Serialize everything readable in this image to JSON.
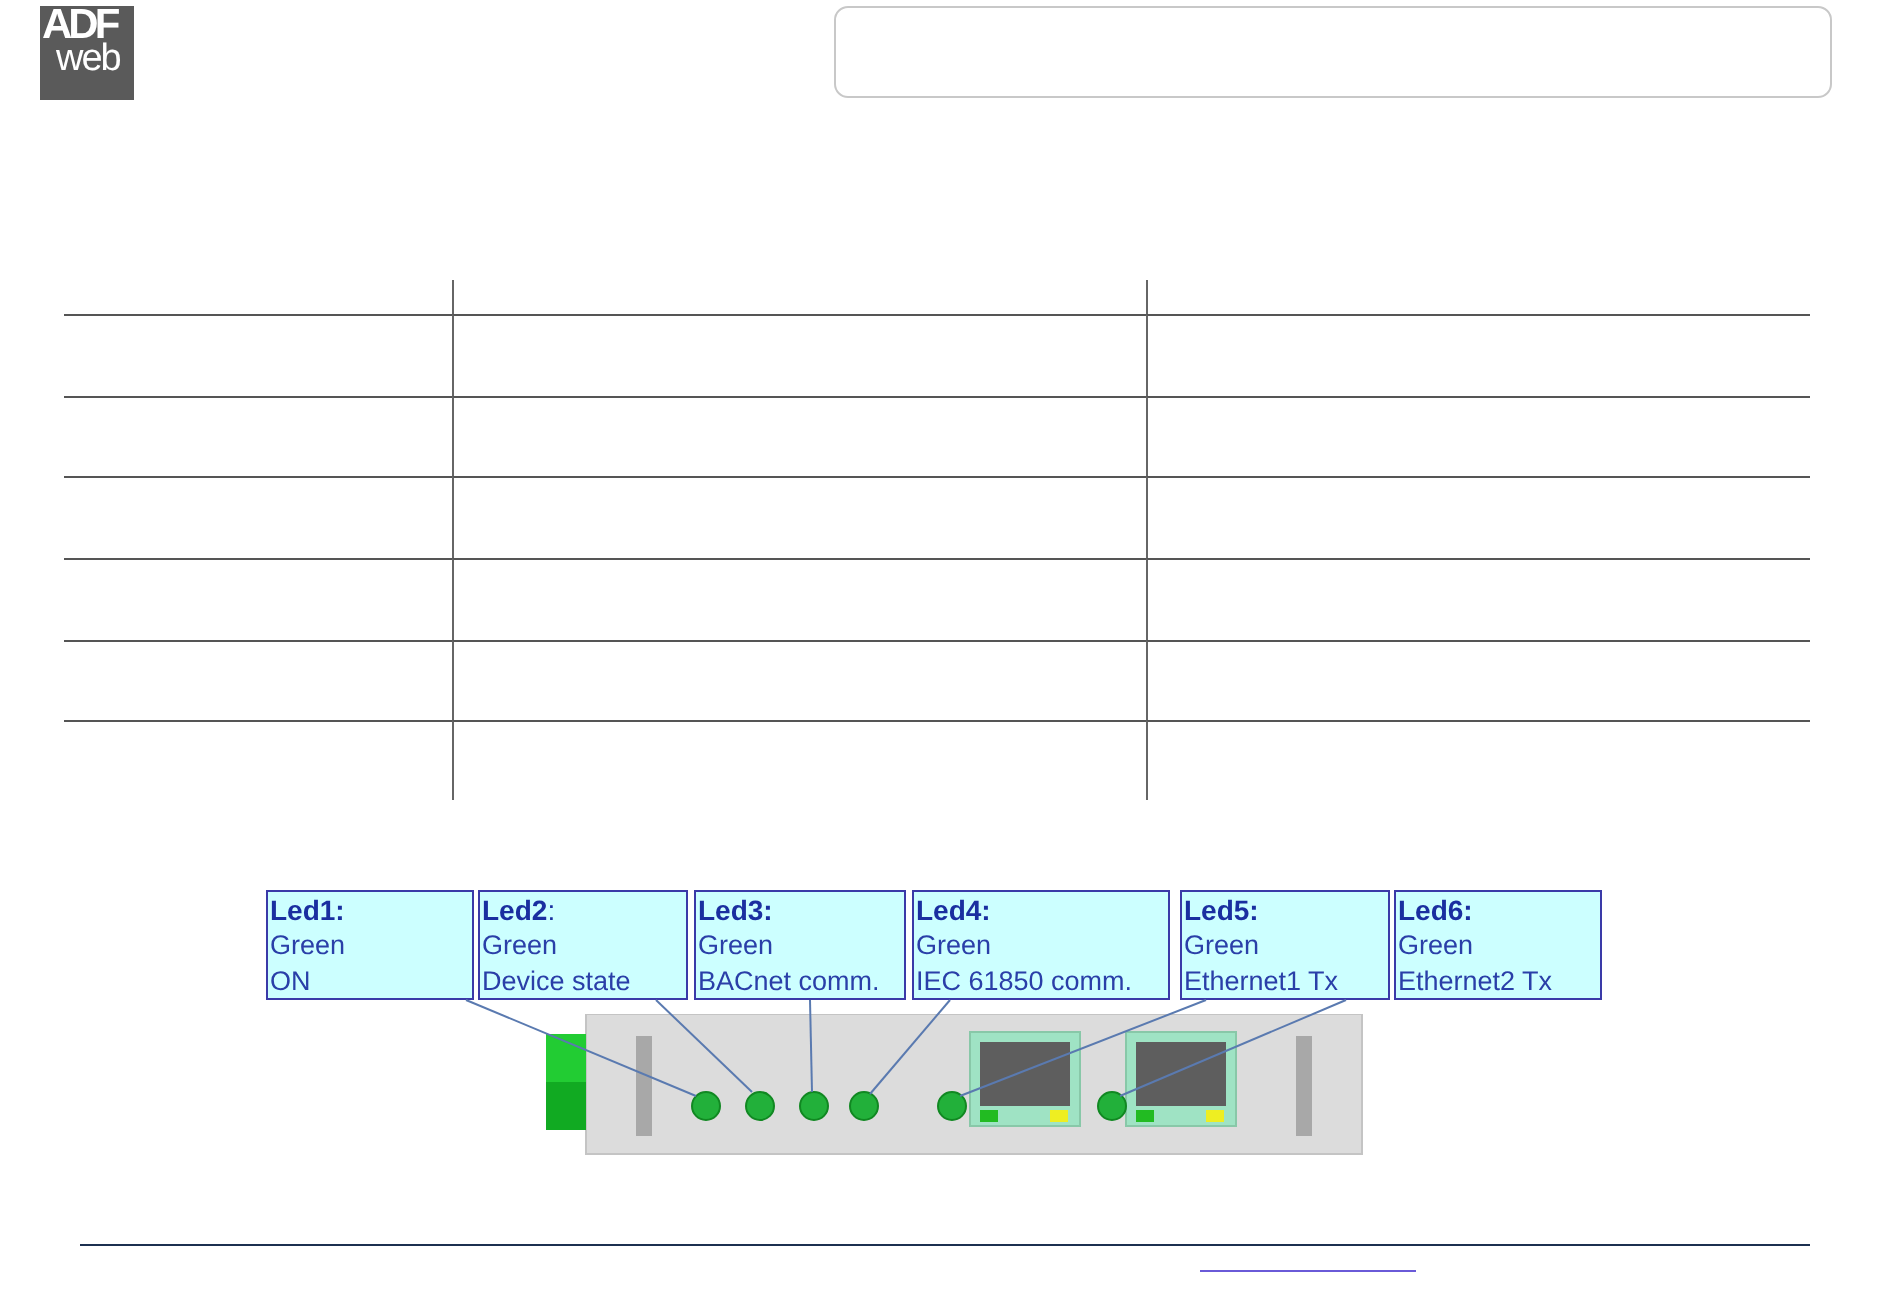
{
  "logo": {
    "line_1": "ADF",
    "line_2": "web"
  },
  "leds": [
    {
      "title": "**Led1:**",
      "light": "Green",
      "function": "ON"
    },
    {
      "title": "**Led2**:",
      "light": "Green",
      "function": "Device state"
    },
    {
      "title": "**Led3:**",
      "light": "Green",
      "function": "BACnet comm."
    },
    {
      "title": "**Led4:**",
      "light": "Green",
      "function": "IEC 61850 comm."
    },
    {
      "title": "**Led5:**",
      "light": "Green",
      "function": "Ethernet1 Tx"
    },
    {
      "title": "**Led6:**",
      "light": "Green",
      "function": "Ethernet2 Tx"
    }
  ]
}
